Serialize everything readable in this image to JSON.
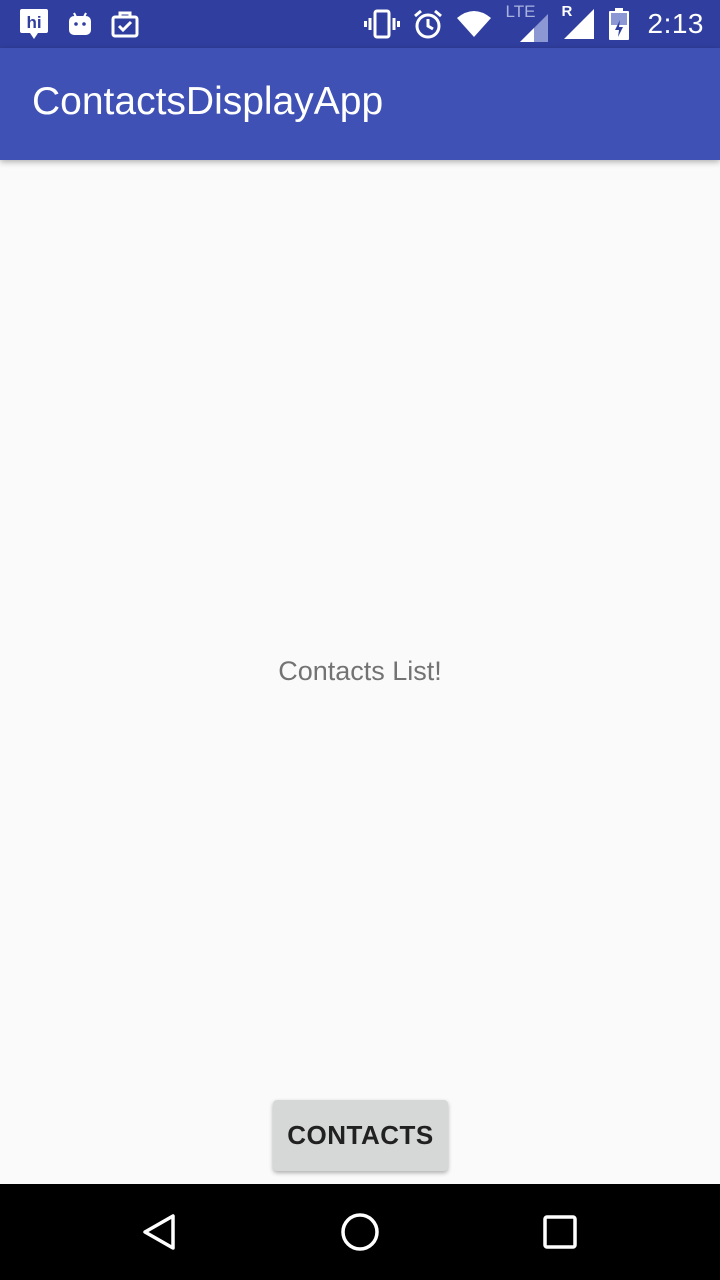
{
  "status_bar": {
    "time": "2:13",
    "network_label": "LTE",
    "roaming_label": "R",
    "notification_icons": [
      "hike-messenger-icon",
      "android-icon",
      "clipboard-check-icon"
    ],
    "system_icons": [
      "vibrate-icon",
      "alarm-icon",
      "wifi-icon",
      "lte-signal-icon",
      "roaming-signal-icon",
      "battery-icon"
    ]
  },
  "app_bar": {
    "title": "ContactsDisplayApp"
  },
  "main": {
    "message": "Contacts List!",
    "contacts_button_label": "CONTACTS"
  },
  "nav_bar": {
    "buttons": [
      "back-button",
      "home-button",
      "recents-button"
    ]
  },
  "colors": {
    "status_bar": "#303f9f",
    "app_bar": "#3f51b5",
    "background": "#fafafa",
    "button": "#d6d7d7",
    "nav_bar": "#000000"
  }
}
